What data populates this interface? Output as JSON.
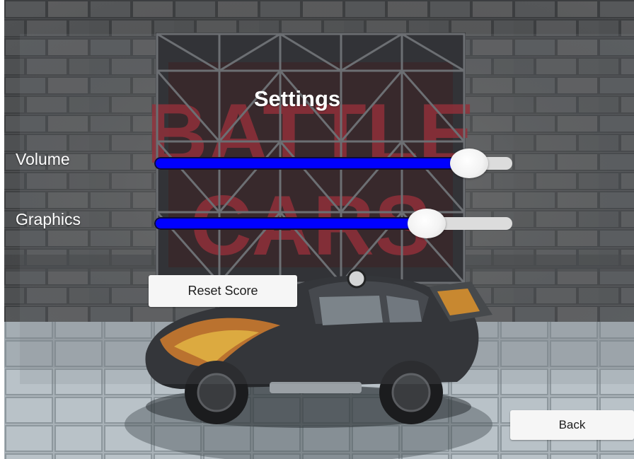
{
  "screen": {
    "title": "Settings"
  },
  "settings": [
    {
      "label": "Volume",
      "value": 0.88
    },
    {
      "label": "Graphics",
      "value": 0.76
    }
  ],
  "buttons": {
    "reset_score": "Reset Score",
    "back": "Back"
  },
  "colors": {
    "slider_fill": "#0000ff",
    "slider_track": "#dcdcdc",
    "button_bg": "#f6f6f6",
    "title_text": "#ffffff"
  },
  "background_banner_text": "BATTLE CARS"
}
